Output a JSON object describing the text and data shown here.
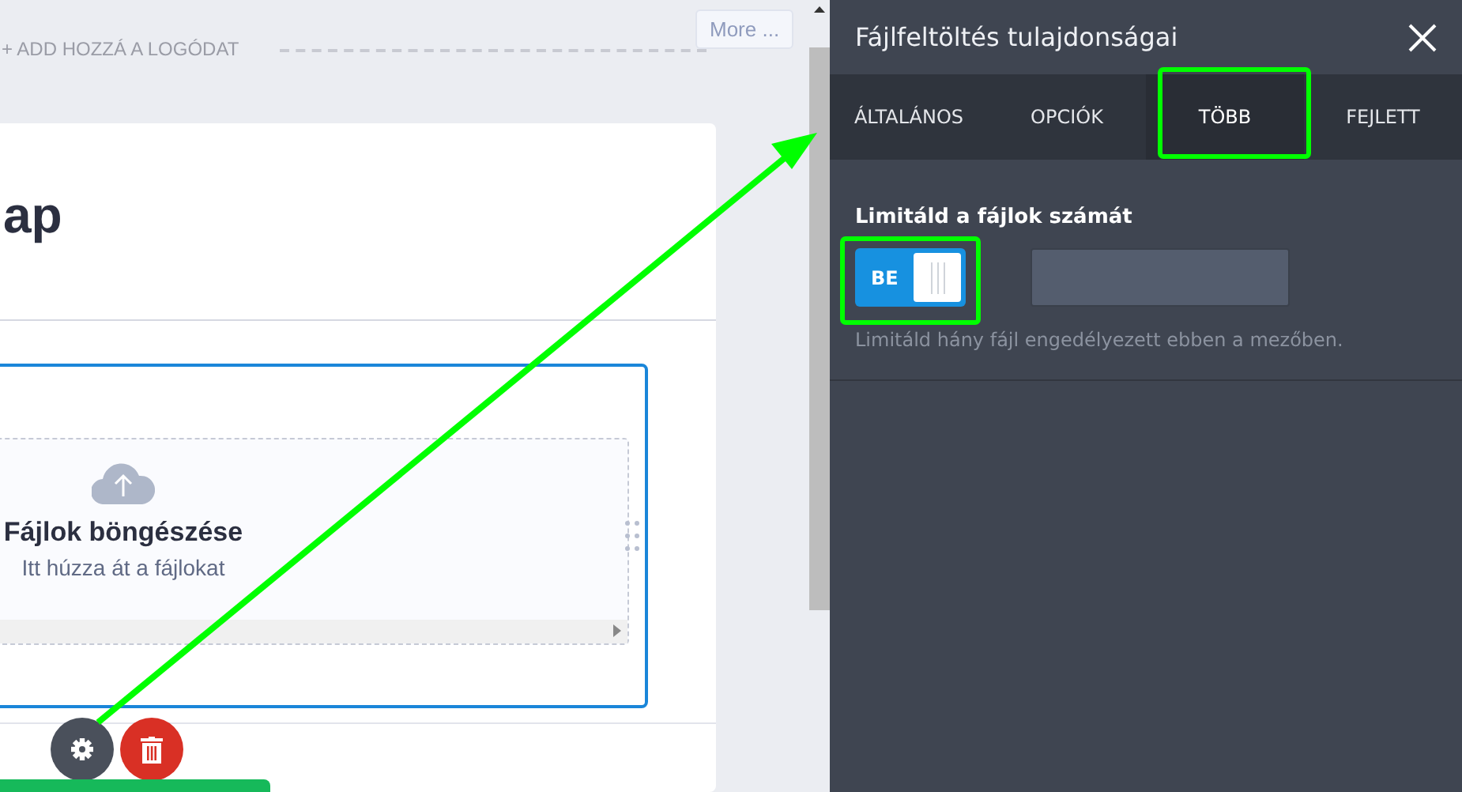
{
  "canvas": {
    "logo_prompt": "+ ADD HOZZÁ A LOGÓDAT",
    "more_button": "More ...",
    "form_title": "ap",
    "upload_field": {
      "browse_label": "Fájlok böngészése",
      "drop_hint": "Itt húzza át a fájlokat"
    }
  },
  "panel": {
    "title": "Fájlfeltöltés tulajdonságai",
    "tabs": [
      {
        "label": "ÁLTALÁNOS",
        "selected": false
      },
      {
        "label": "OPCIÓK",
        "selected": false
      },
      {
        "label": "TÖBB",
        "selected": true
      },
      {
        "label": "FEJLETT",
        "selected": false
      }
    ],
    "setting": {
      "label": "Limitáld a fájlok számát",
      "toggle": {
        "label": "BE",
        "on": true
      },
      "help": "Limitáld hány fájl engedélyezett ebben a mezőben."
    }
  }
}
